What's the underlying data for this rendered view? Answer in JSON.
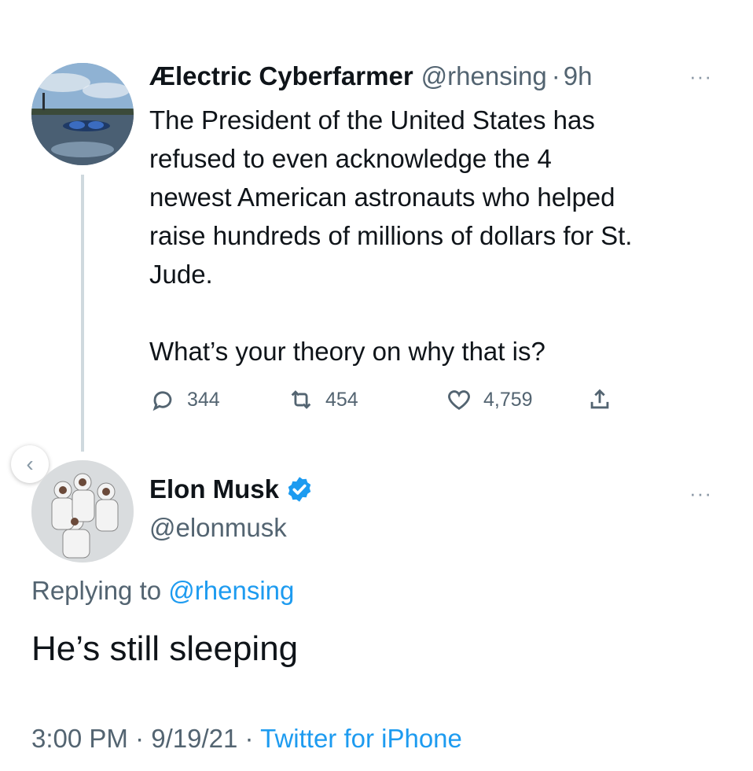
{
  "parent_tweet": {
    "display_name": "Ælectric Cyberfarmer",
    "handle": "@rhensing",
    "time_sep": "·",
    "time": "9h",
    "more": "···",
    "text": "The President of the United States has\nrefused to even acknowledge the 4\nnewest American astronauts who helped\nraise hundreds of millions of dollars for St.\nJude.\n\nWhat’s your theory on why that is?",
    "replies": "344",
    "retweets": "454",
    "likes": "4,759"
  },
  "carousel": {
    "back_glyph": "‹"
  },
  "reply_tweet": {
    "display_name": "Elon Musk",
    "handle": "@elonmusk",
    "more": "···",
    "replying_prefix": "Replying to",
    "replying_to": "@rhensing",
    "text": "He’s still sleeping",
    "time": "3:00 PM",
    "sep1": "·",
    "date": "9/19/21",
    "sep2": "·",
    "source": "Twitter for iPhone"
  },
  "colors": {
    "accent": "#1d9bf0",
    "muted": "#536471",
    "text": "#0f1419",
    "thread": "#cfd9de"
  }
}
